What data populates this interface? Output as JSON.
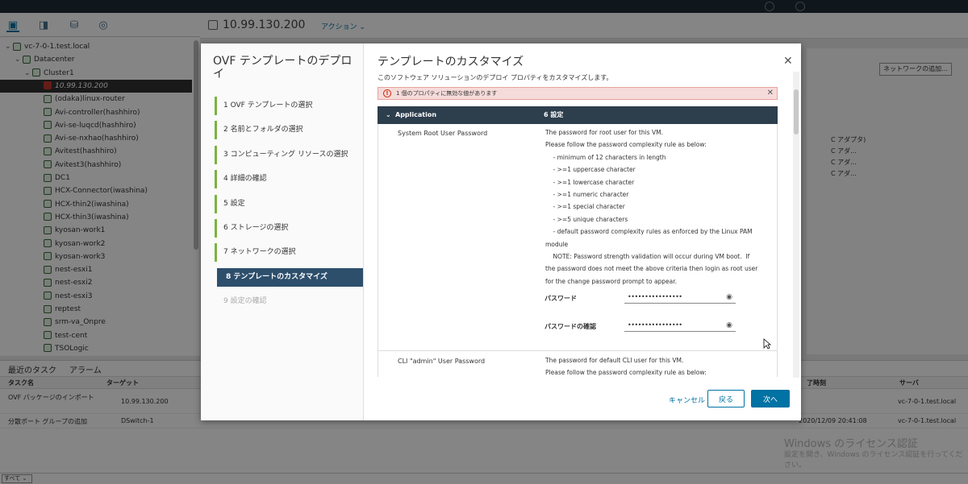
{
  "background": {
    "host_title": "10.99.130.200",
    "actions_label": "アクション ⌄",
    "tree": [
      {
        "label": "vc-7-0-1.test.local",
        "indent": 0,
        "arrow": "⌄"
      },
      {
        "label": "Datacenter",
        "indent": 1,
        "arrow": "⌄"
      },
      {
        "label": "Cluster1",
        "indent": 2,
        "arrow": "⌄"
      },
      {
        "label": "10.99.130.200",
        "indent": 3,
        "arrow": "",
        "selected": true
      },
      {
        "label": "(odaka)linux-router",
        "indent": 3,
        "arrow": ""
      },
      {
        "label": "Avi-controller(hashhiro)",
        "indent": 3,
        "arrow": ""
      },
      {
        "label": "Avi-se-luqcd(hashhiro)",
        "indent": 3,
        "arrow": ""
      },
      {
        "label": "Avi-se-nxhao(hashhiro)",
        "indent": 3,
        "arrow": ""
      },
      {
        "label": "Avitest(hashhiro)",
        "indent": 3,
        "arrow": ""
      },
      {
        "label": "Avitest3(hashhiro)",
        "indent": 3,
        "arrow": ""
      },
      {
        "label": "DC1",
        "indent": 3,
        "arrow": ""
      },
      {
        "label": "HCX-Connector(iwashina)",
        "indent": 3,
        "arrow": ""
      },
      {
        "label": "HCX-thin2(iwashina)",
        "indent": 3,
        "arrow": ""
      },
      {
        "label": "HCX-thin3(iwashina)",
        "indent": 3,
        "arrow": ""
      },
      {
        "label": "kyosan-work1",
        "indent": 3,
        "arrow": ""
      },
      {
        "label": "kyosan-work2",
        "indent": 3,
        "arrow": ""
      },
      {
        "label": "kyosan-work3",
        "indent": 3,
        "arrow": ""
      },
      {
        "label": "nest-esxi1",
        "indent": 3,
        "arrow": ""
      },
      {
        "label": "nest-esxi2",
        "indent": 3,
        "arrow": ""
      },
      {
        "label": "nest-esxi3",
        "indent": 3,
        "arrow": ""
      },
      {
        "label": "reptest",
        "indent": 3,
        "arrow": ""
      },
      {
        "label": "srm-va_Onpre",
        "indent": 3,
        "arrow": ""
      },
      {
        "label": "test-cent",
        "indent": 3,
        "arrow": ""
      },
      {
        "label": "TSOLogic",
        "indent": 3,
        "arrow": ""
      }
    ],
    "network_button": "ネットワークの追加...",
    "adapters": [
      "C アダプタ)",
      "C アダ...",
      "C アダ...",
      "C アダ..."
    ],
    "tasks": {
      "tab_recent": "最近のタスク",
      "tab_alarms": "アラーム",
      "col_task": "タスク名",
      "col_target": "ターゲット",
      "col_end": "了時刻",
      "col_server": "サーバ",
      "rows": [
        {
          "task": "OVF パッケージのインポート",
          "target": "10.99.130.200",
          "end": "",
          "server": "vc-7-0-1.test.local"
        },
        {
          "task": "分散ポート グループの追加",
          "target": "DSwitch-1",
          "end": "2020/12/09 20:41:08",
          "server": "vc-7-0-1.test.local"
        }
      ]
    },
    "all_button": "すべて ⌄",
    "watermark_title": "Windows のライセンス認証",
    "watermark_sub": "設定を開き、Windows のライセンス認証を行ってください。"
  },
  "dialog": {
    "wizard_title": "OVF テンプレートのデプロイ",
    "steps": [
      {
        "label": "1  OVF テンプレートの選択",
        "state": "done"
      },
      {
        "label": "2  名前とフォルダの選択",
        "state": "done"
      },
      {
        "label": "3  コンピューティング リソースの選択",
        "state": "done"
      },
      {
        "label": "4  詳細の確認",
        "state": "done"
      },
      {
        "label": "5  設定",
        "state": "done"
      },
      {
        "label": "6  ストレージの選択",
        "state": "done"
      },
      {
        "label": "7  ネットワークの選択",
        "state": "done"
      },
      {
        "label": "8  テンプレートのカスタマイズ",
        "state": "active"
      },
      {
        "label": "9  設定の確認",
        "state": "disabled"
      }
    ],
    "title": "テンプレートのカスタマイズ",
    "subtitle": "このソフトウェア ソリューションのデプロイ プロパティをカスタマイズします。",
    "alert_text": "1 個のプロパティに無効な値があります",
    "section_name": "Application",
    "section_count": "6 設定",
    "prop1_label": "System Root User Password",
    "prop1_desc": "The password for root user for this VM.\nPlease follow the password complexity rule as below:\n    - minimum of 12 characters in length\n    - >=1 uppercase character\n    - >=1 lowercase character\n    - >=1 numeric character\n    - >=1 special character\n    - >=5 unique characters\n    - default password complexity rules as enforced by the Linux PAM\nmodule\n    NOTE: Password strength validation will occur during VM boot.  If\nthe password does not meet the above criteria then login as root user\nfor the change password prompt to appear.",
    "password_label": "パスワード",
    "password_value": "••••••••••••••••",
    "confirm_label": "パスワードの確認",
    "confirm_value": "••••••••••••••••",
    "prop2_label": "CLI \"admin\" User Password",
    "prop2_desc": "The password for default CLI user for this VM.\nPlease follow the password complexity rule as below:",
    "cancel": "キャンセル",
    "back": "戻る",
    "next": "次へ"
  }
}
